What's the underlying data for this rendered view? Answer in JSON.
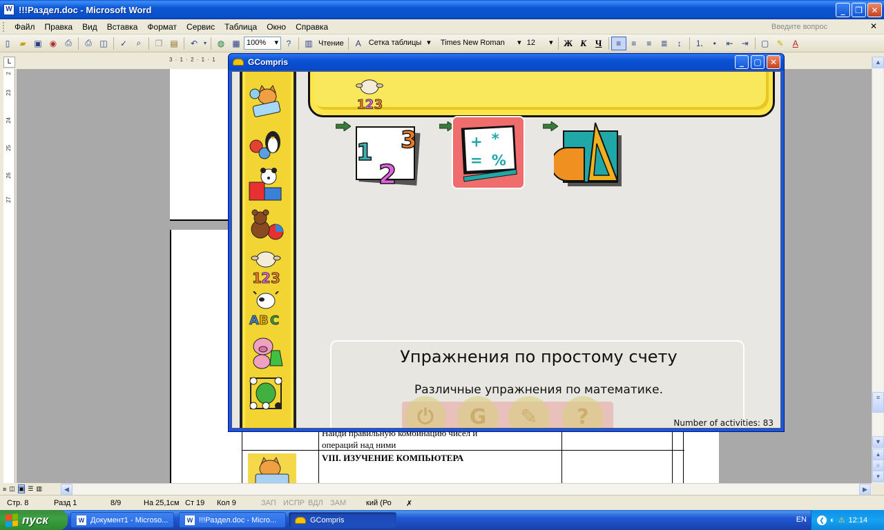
{
  "word": {
    "title": "!!!Раздел.doc - Microsoft Word",
    "menu": [
      "Файл",
      "Правка",
      "Вид",
      "Вставка",
      "Формат",
      "Сервис",
      "Таблица",
      "Окно",
      "Справка"
    ],
    "ask_placeholder": "Введите вопрос",
    "toolbar": {
      "zoom": "100%",
      "reading": "Чтение",
      "style": "Сетка таблицы",
      "font": "Times New Roman",
      "size": "12",
      "bold": "Ж",
      "italic": "К",
      "underline": "Ч"
    },
    "ruler_h": "3 · 1 · 2 · 1 · 1",
    "ruler_v": [
      "2",
      "23",
      "24",
      "25",
      "26",
      "27"
    ],
    "document": {
      "cell_text_1": "Найди правильную комбинацию чисел и",
      "cell_text_2": "операций над ними",
      "section_heading": "VIII. ИЗУЧЕНИЕ КОМПЬЮТЕРА"
    },
    "status": {
      "page": "Стр. 8",
      "section": "Разд 1",
      "pages": "8/9",
      "at": "На 25,1см",
      "line": "Ст 19",
      "col": "Кол 9",
      "rec": "ЗАП",
      "trk": "ИСПР",
      "ext": "ВДЛ",
      "ovr": "ЗАМ",
      "lang": "кий (Ро"
    }
  },
  "gcompris": {
    "title": "GCompris",
    "info_title": "Упражнения по простому счету",
    "info_desc": "Различные упражнения по математике.",
    "activity_count": "Number of activities: 83"
  },
  "taskbar": {
    "start": "пуск",
    "tasks": [
      "Документ1 - Microso...",
      "!!!Раздел.doc - Micro...",
      "GCompris"
    ],
    "lang": "EN",
    "time": "12:14"
  },
  "colors": {
    "xp_blue": "#0a4fc8",
    "gc_yellow": "#fbe54a",
    "selected_tile": "#ef6d6d",
    "arrow_green": "#3a7a3a"
  }
}
